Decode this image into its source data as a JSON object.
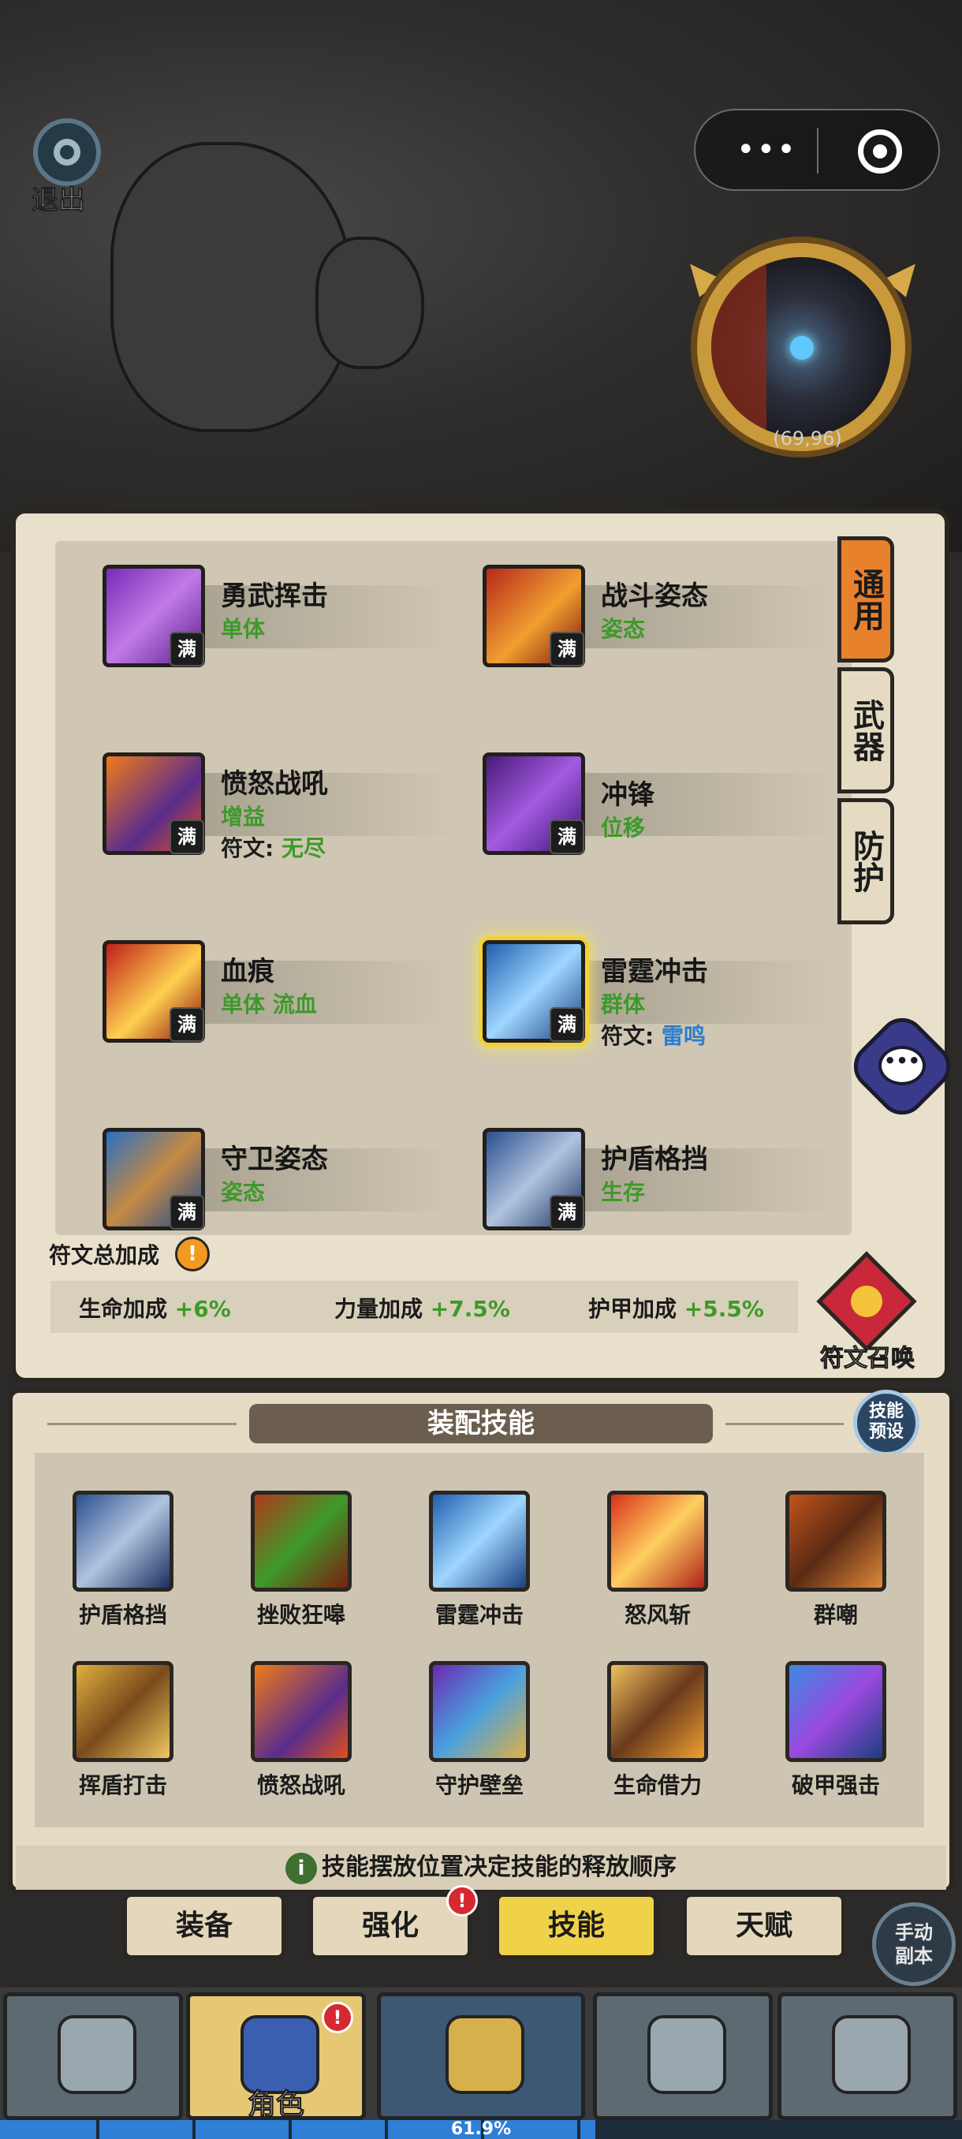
{
  "topbar": {
    "exit_label": "退出",
    "capsule_dots": "•••",
    "minimap_coord": "(69,96)"
  },
  "skills": [
    {
      "name": "勇武挥击",
      "tag": "单体",
      "rune_label": "",
      "rune_value": "",
      "full": "满",
      "icon": "sword-slash-icon",
      "color": "purple",
      "selected": false
    },
    {
      "name": "战斗姿态",
      "tag": "姿态",
      "rune_label": "",
      "rune_value": "",
      "full": "满",
      "icon": "battle-stance-icon",
      "color": "red",
      "selected": false
    },
    {
      "name": "愤怒战吼",
      "tag": "增益",
      "rune_label": "符文:",
      "rune_value": "无尽",
      "full": "满",
      "icon": "battle-shout-icon",
      "color": "flame",
      "selected": false
    },
    {
      "name": "冲锋",
      "tag": "位移",
      "rune_label": "",
      "rune_value": "",
      "full": "满",
      "icon": "charge-icon",
      "color": "violet",
      "selected": false
    },
    {
      "name": "血痕",
      "tag": "单体 流血",
      "rune_label": "",
      "rune_value": "",
      "full": "满",
      "icon": "blood-slash-icon",
      "color": "blood",
      "selected": false
    },
    {
      "name": "雷霆冲击",
      "tag": "群体",
      "rune_label": "符文:",
      "rune_value": "雷鸣",
      "full": "满",
      "icon": "thunder-hammer-icon",
      "color": "blue",
      "selected": true
    },
    {
      "name": "守卫姿态",
      "tag": "姿态",
      "rune_label": "",
      "rune_value": "",
      "full": "满",
      "icon": "guard-shield-icon",
      "color": "shield",
      "selected": false
    },
    {
      "name": "护盾格挡",
      "tag": "生存",
      "rune_label": "",
      "rune_value": "",
      "full": "满",
      "icon": "shield-block-icon",
      "color": "steel",
      "selected": false
    }
  ],
  "category_tabs": [
    {
      "label": "通用",
      "active": true
    },
    {
      "label": "武器",
      "active": false
    },
    {
      "label": "防护",
      "active": false
    }
  ],
  "rune_summary": {
    "title": "符文总加成",
    "warn": "!",
    "bonuses": [
      {
        "label": "生命加成",
        "value": "+6%"
      },
      {
        "label": "力量加成",
        "value": "+7.5%"
      },
      {
        "label": "护甲加成",
        "value": "+5.5%"
      }
    ],
    "summon_label": "符文召唤"
  },
  "equip": {
    "title": "装配技能",
    "preset_label_1": "技能",
    "preset_label_2": "预设",
    "slots": [
      {
        "label": "护盾格挡",
        "icon": "shield-block-icon",
        "color": "steel"
      },
      {
        "label": "挫败狂嗥",
        "icon": "roar-icon",
        "color": "green"
      },
      {
        "label": "雷霆冲击",
        "icon": "thunder-hammer-icon",
        "color": "blue"
      },
      {
        "label": "怒风斩",
        "icon": "fire-slash-icon",
        "color": "fire"
      },
      {
        "label": "群嘲",
        "icon": "taunt-icon",
        "color": "dark"
      },
      {
        "label": "挥盾打击",
        "icon": "shield-bash-icon",
        "color": "gold"
      },
      {
        "label": "愤怒战吼",
        "icon": "battle-shout-icon",
        "color": "flame"
      },
      {
        "label": "守护壁垒",
        "icon": "guardian-barrier-icon",
        "color": "arcane"
      },
      {
        "label": "生命借力",
        "icon": "life-borrow-icon",
        "color": "brown"
      },
      {
        "label": "破甲强击",
        "icon": "armor-break-icon",
        "color": "cleave"
      }
    ],
    "tip_icon": "i",
    "tip": "技能摆放位置决定技能的释放顺序"
  },
  "sub_tabs": [
    {
      "label": "装备",
      "active": false,
      "badge": ""
    },
    {
      "label": "强化",
      "active": false,
      "badge": "!"
    },
    {
      "label": "技能",
      "active": true,
      "badge": ""
    },
    {
      "label": "天赋",
      "active": false,
      "badge": ""
    }
  ],
  "manual_dungeon": {
    "line1": "手动",
    "line2": "副本"
  },
  "bottom_nav": [
    {
      "label": "",
      "icon": "rock-dungeon-icon",
      "active": false
    },
    {
      "label": "角色",
      "icon": "hooded-hero-icon",
      "active": true,
      "badge": "!"
    },
    {
      "label": "",
      "icon": "battle-crossed-swords-icon",
      "active": false
    },
    {
      "label": "",
      "icon": "altar-icon",
      "active": false
    },
    {
      "label": "",
      "icon": "castle-icon",
      "active": false
    }
  ],
  "progress": {
    "value_percent": 61.9,
    "text": "61.9%"
  }
}
